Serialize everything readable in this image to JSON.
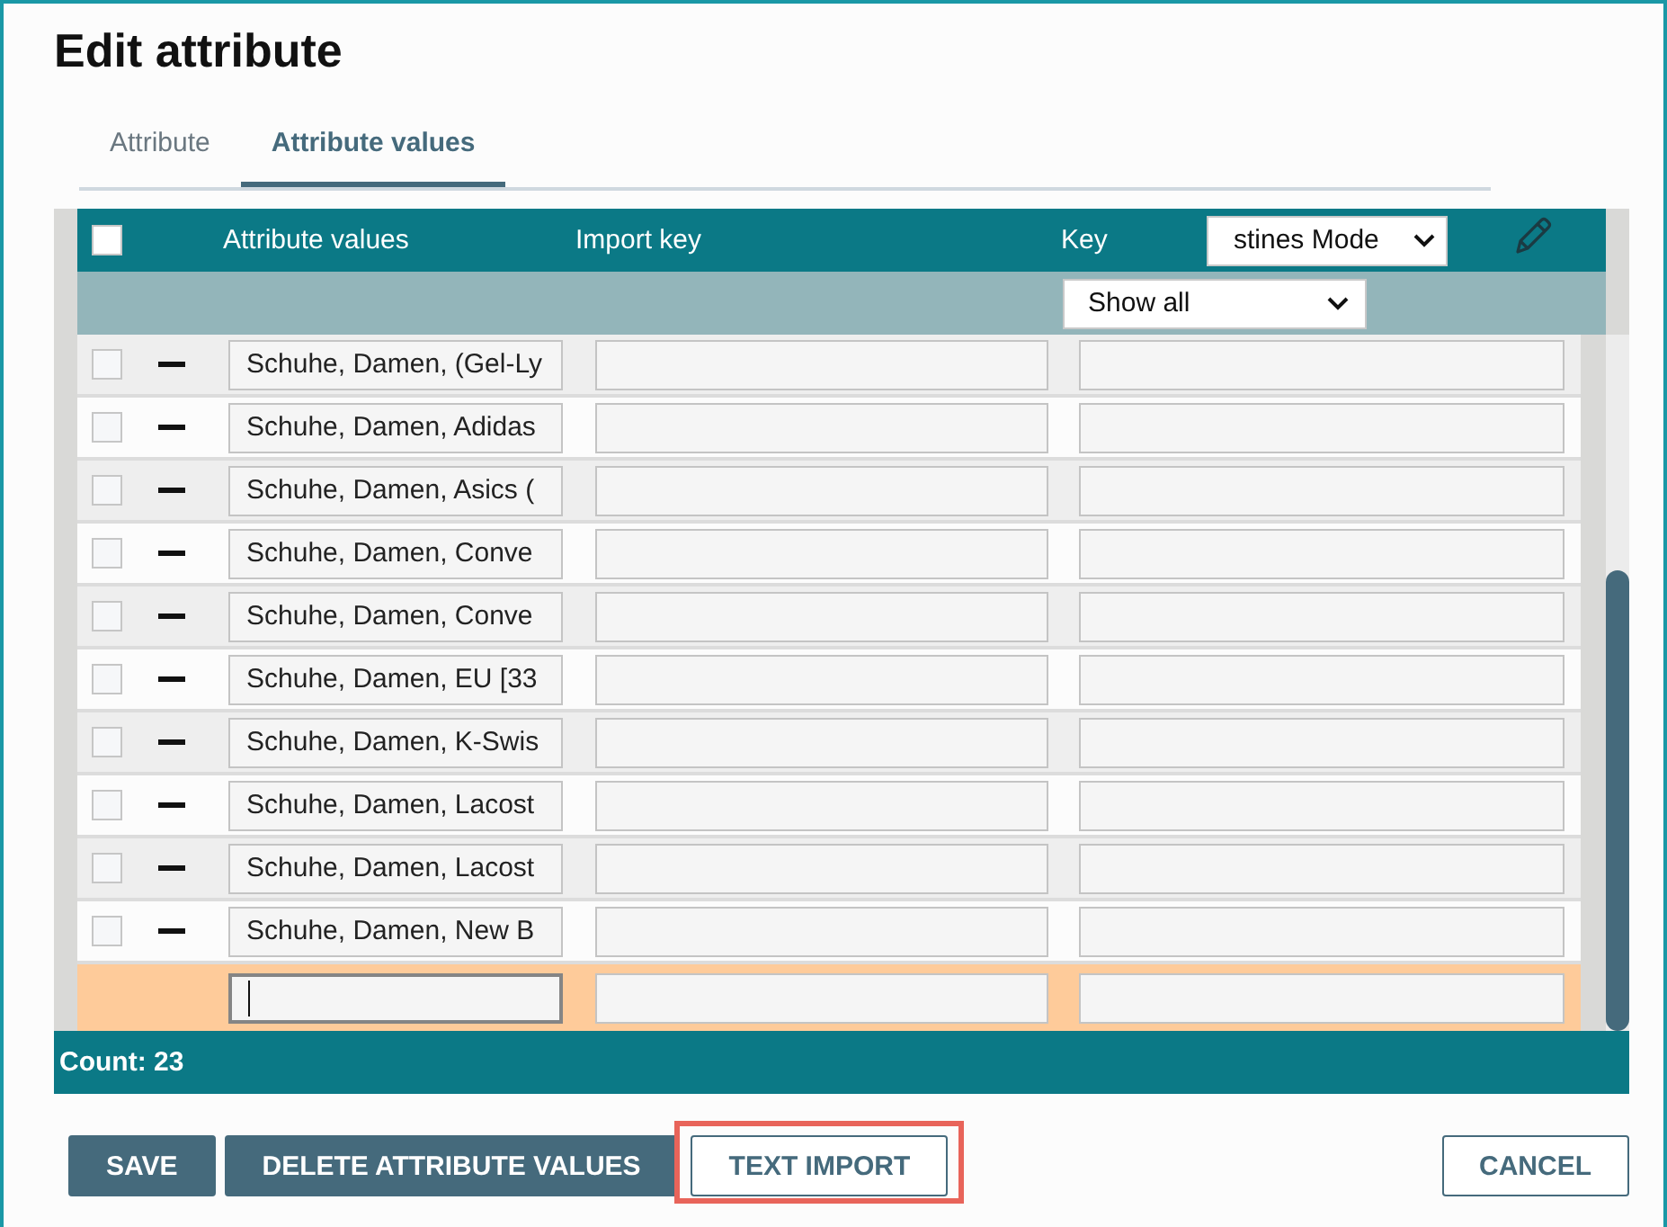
{
  "dialog": {
    "title": "Edit attribute"
  },
  "tabs": [
    {
      "label": "Attribute",
      "selected": false
    },
    {
      "label": "Attribute values",
      "selected": true
    }
  ],
  "table": {
    "select_all_checked": false,
    "columns": [
      "Attribute values",
      "Import key",
      "Key"
    ],
    "key_dropdown": {
      "value": "stines Mode"
    },
    "filter": {
      "value": "Show all"
    },
    "rows": [
      {
        "checked": false,
        "value": "Schuhe, Damen, (Gel-Ly"
      },
      {
        "checked": false,
        "value": "Schuhe, Damen, Adidas"
      },
      {
        "checked": false,
        "value": "Schuhe, Damen, Asics ("
      },
      {
        "checked": false,
        "value": "Schuhe, Damen, Conve"
      },
      {
        "checked": false,
        "value": "Schuhe, Damen, Conve"
      },
      {
        "checked": false,
        "value": "Schuhe, Damen, EU [33"
      },
      {
        "checked": false,
        "value": "Schuhe, Damen, K-Swis"
      },
      {
        "checked": false,
        "value": "Schuhe, Damen, Lacost"
      },
      {
        "checked": false,
        "value": "Schuhe, Damen, Lacost"
      },
      {
        "checked": false,
        "value": "Schuhe, Damen, New B"
      }
    ],
    "new_row": {
      "focused": true
    },
    "count": "Count: 23"
  },
  "footer": {
    "actions": [
      {
        "label": "SAVE",
        "kind": "primary",
        "highlighted": false
      },
      {
        "label": "DELETE ATTRIBUTE VALUES",
        "kind": "primary",
        "highlighted": false
      },
      {
        "label": "TEXT IMPORT",
        "kind": "outline",
        "highlighted": true
      }
    ],
    "cancel": {
      "label": "CANCEL"
    }
  }
}
